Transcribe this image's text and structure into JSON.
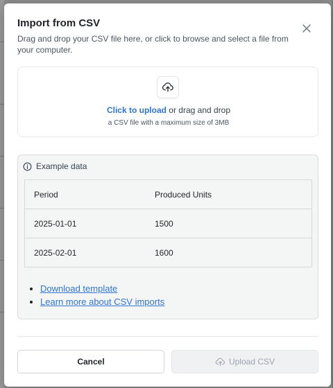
{
  "dialog": {
    "title": "Import from CSV",
    "description": "Drag and drop your CSV file here, or click to browse and select a file from your computer."
  },
  "dropzone": {
    "link_text": "Click to upload",
    "rest_text": " or drag and drop",
    "hint": "a CSV file with a maximum size of 3MB"
  },
  "example": {
    "heading": "Example data",
    "columns": [
      "Period",
      "Produced Units"
    ],
    "rows": [
      [
        "2025-01-01",
        "1500"
      ],
      [
        "2025-02-01",
        "1600"
      ]
    ]
  },
  "links": {
    "download_template": "Download template",
    "learn_more": "Learn more about CSV imports"
  },
  "footer": {
    "cancel_label": "Cancel",
    "upload_label": "Upload CSV"
  },
  "colors": {
    "accent": "#2f74d0",
    "backdrop": "#8c8c8c"
  },
  "icons": {
    "close": "close-icon",
    "upload": "upload-icon",
    "info": "info-icon"
  }
}
